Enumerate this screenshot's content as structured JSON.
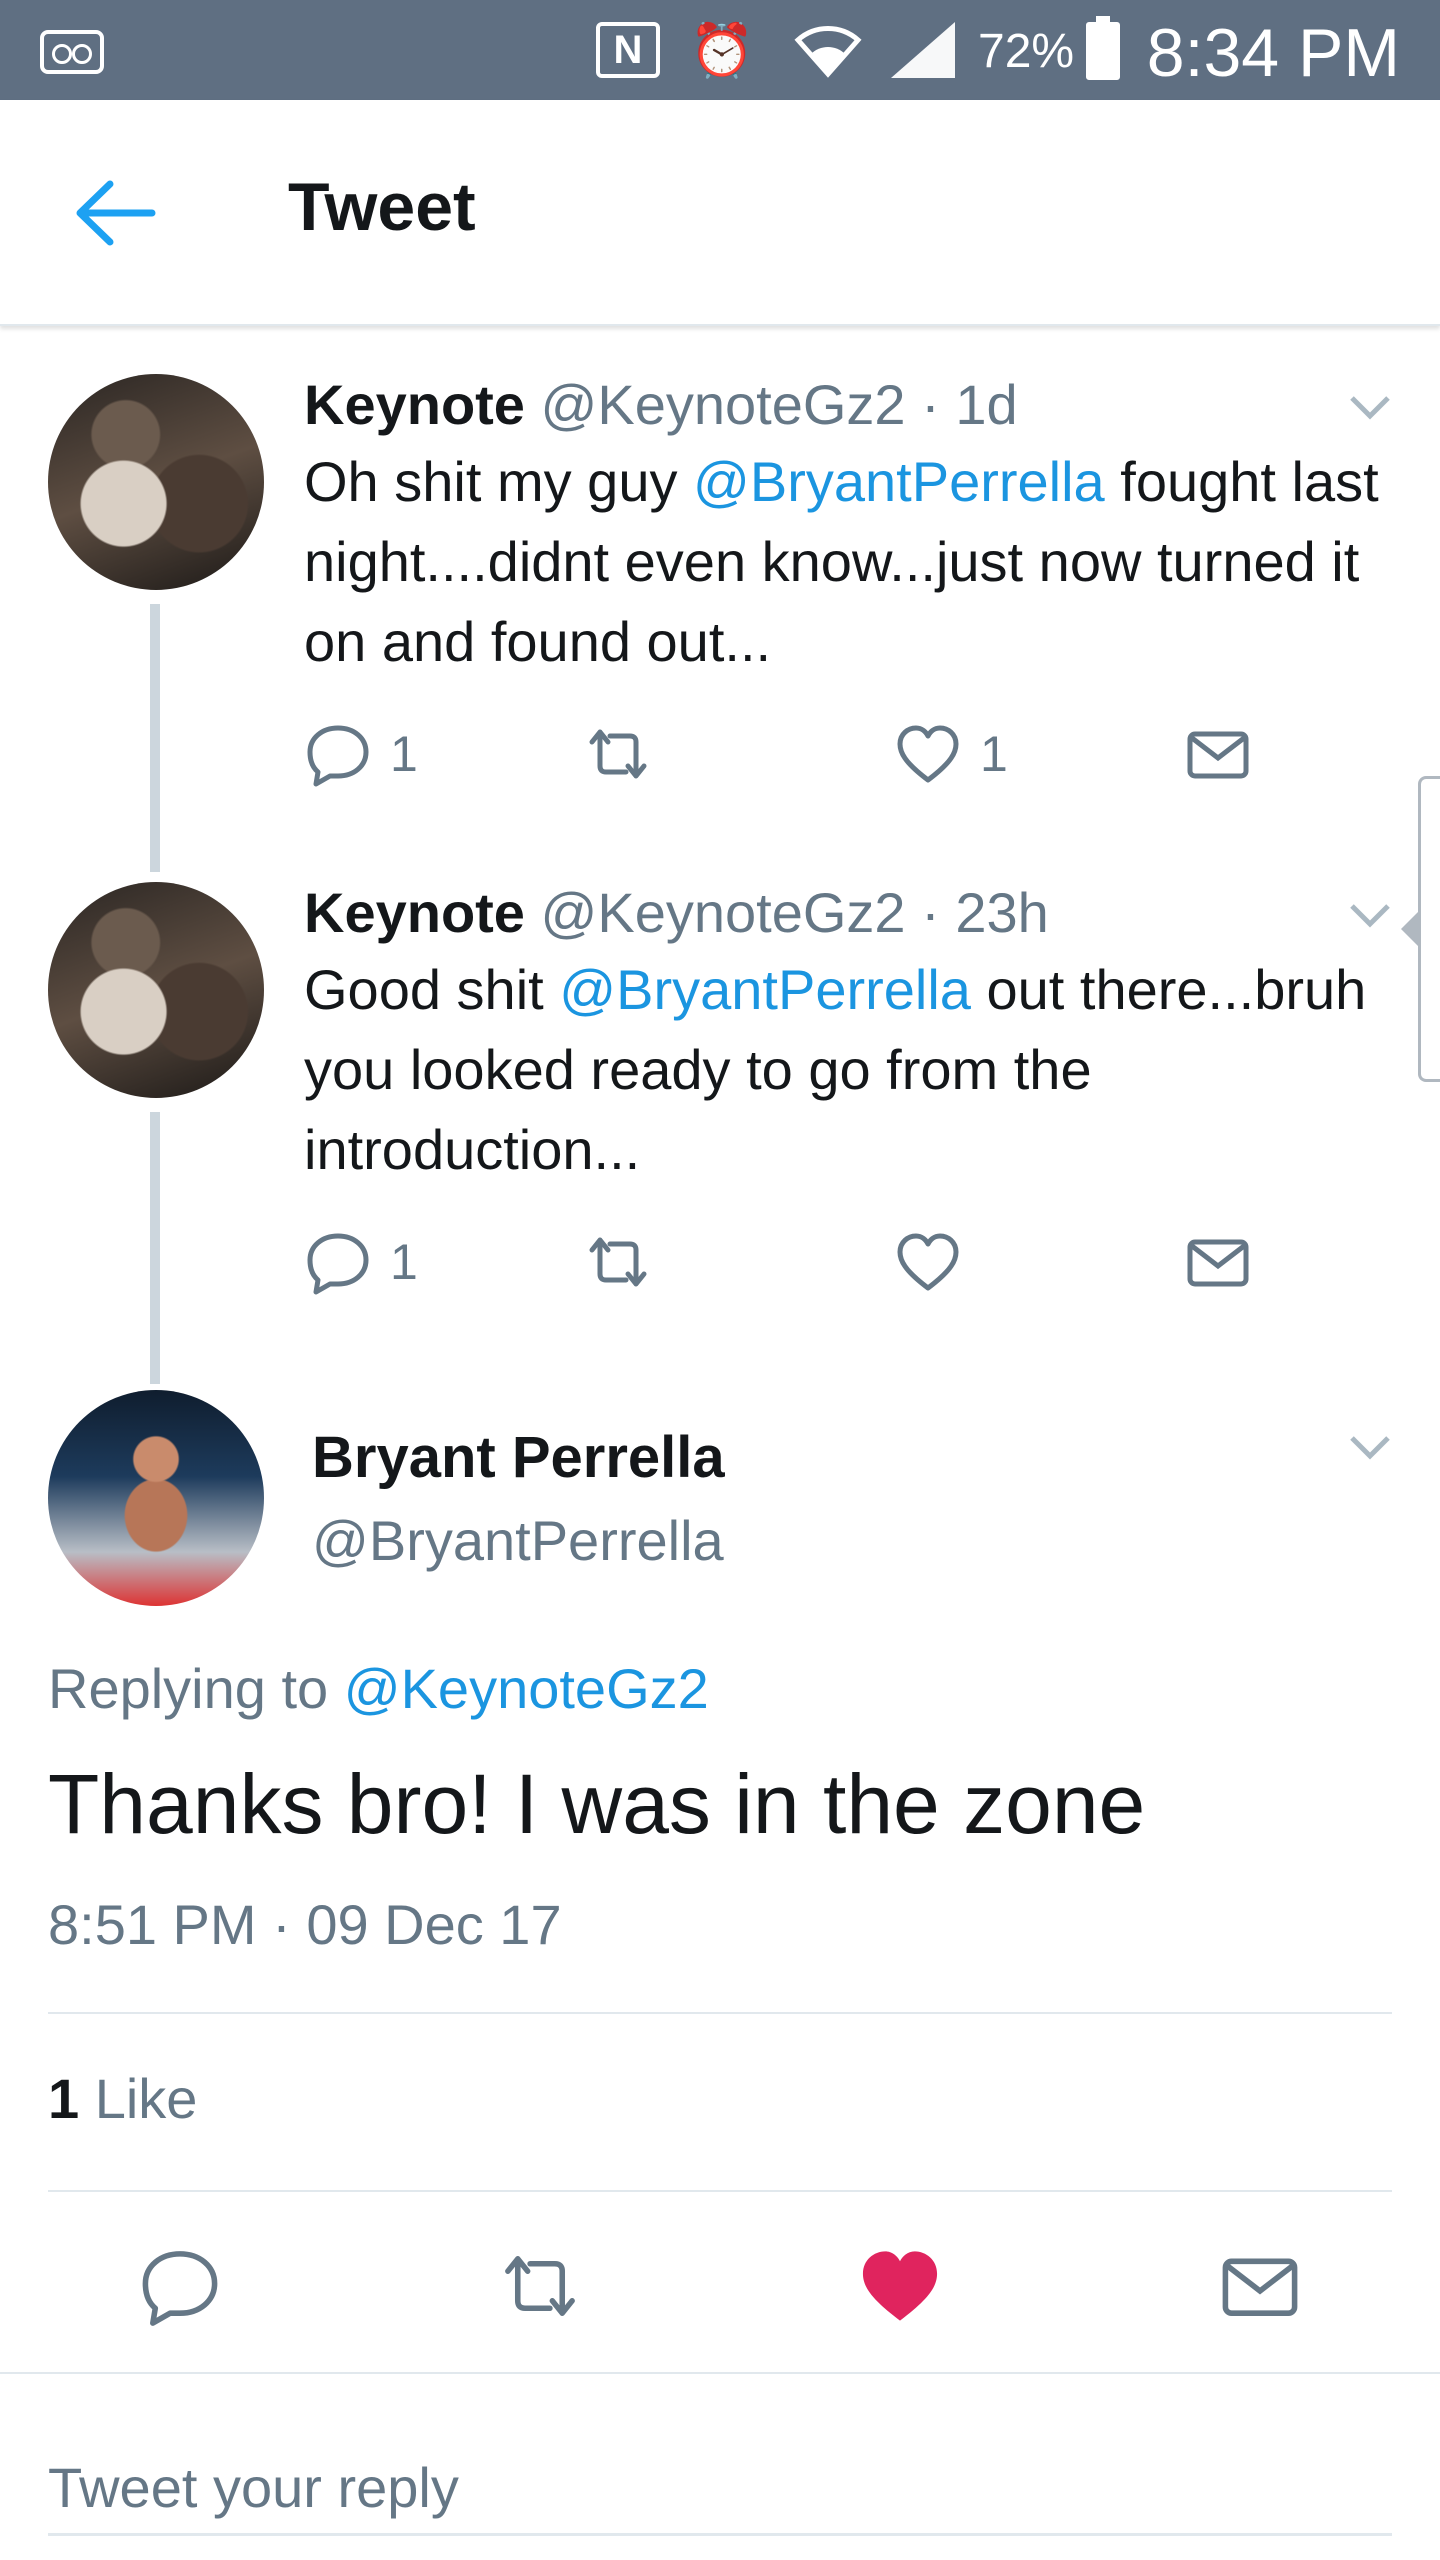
{
  "status_bar": {
    "nfc_label": "N",
    "alarm_icon": "alarm-clock-icon",
    "battery": "72%",
    "time": "8:34 PM"
  },
  "header": {
    "title": "Tweet",
    "back_icon": "back-arrow-icon"
  },
  "thread": [
    {
      "name": "Keynote",
      "handle": "@KeynoteGz2",
      "separator": " · ",
      "time": "1d",
      "text_parts": [
        "Oh shit my guy ",
        "@BryantPerrella",
        " fought last night....didnt even know...just now turned it on and found out..."
      ],
      "reply_count": "1",
      "like_count": "1"
    },
    {
      "name": "Keynote",
      "handle": "@KeynoteGz2",
      "separator": " · ",
      "time": "23h",
      "text_parts": [
        "Good shit ",
        "@BryantPerrella",
        " out there...bruh you looked ready to go from the introduction..."
      ],
      "reply_count": "1",
      "like_count": ""
    }
  ],
  "main_tweet": {
    "name": "Bryant Perrella",
    "handle": "@BryantPerrella",
    "replying_prefix": "Replying to ",
    "replying_handle": "@KeynoteGz2",
    "text": "Thanks bro! I was in the zone",
    "timestamp": "8:51 PM · 09 Dec 17",
    "likes_number": "1",
    "likes_label": " Like",
    "liked": true,
    "like_color": "#e0245e"
  },
  "reply": {
    "placeholder": "Tweet your reply"
  },
  "colors": {
    "status_bar": "#5f6f82",
    "accent": "#1b95e0",
    "secondary_text": "#657786",
    "divider": "#e1e8ed"
  }
}
